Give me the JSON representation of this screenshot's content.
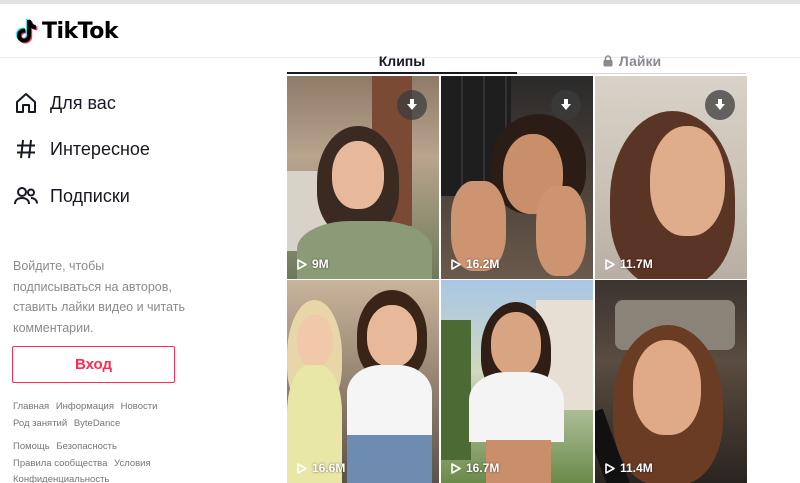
{
  "brand": {
    "logo_text": "TikTok"
  },
  "sidebar": {
    "items": [
      {
        "label": "Для вас",
        "icon": "home-icon"
      },
      {
        "label": "Интересное",
        "icon": "hashtag-icon"
      },
      {
        "label": "Подписки",
        "icon": "users-icon"
      }
    ],
    "login_prompt": "Войдите, чтобы подписываться на авторов, ставить лайки видео и читать комментарии.",
    "login_button": "Вход",
    "footer_rows": [
      [
        "Главная",
        "Информация",
        "Новости"
      ],
      [
        "Род занятий",
        "ByteDance"
      ],
      [
        "Помощь",
        "Безопасность"
      ],
      [
        "Правила сообщества",
        "Условия"
      ],
      [
        "Конфиденциальность"
      ]
    ]
  },
  "tabs": [
    {
      "label": "Клипы",
      "active": true
    },
    {
      "label": "Лайки",
      "active": false,
      "icon": "lock-icon"
    }
  ],
  "videos": [
    {
      "views": "9M",
      "download": true
    },
    {
      "views": "16.2M",
      "download": true
    },
    {
      "views": "11.7M",
      "download": true
    },
    {
      "views": "16.6M",
      "download": false
    },
    {
      "views": "16.7M",
      "download": false
    },
    {
      "views": "11.4M",
      "download": false
    }
  ],
  "colors": {
    "accent": "#fe2c55",
    "text": "#161823",
    "muted": "#8a8b91"
  }
}
